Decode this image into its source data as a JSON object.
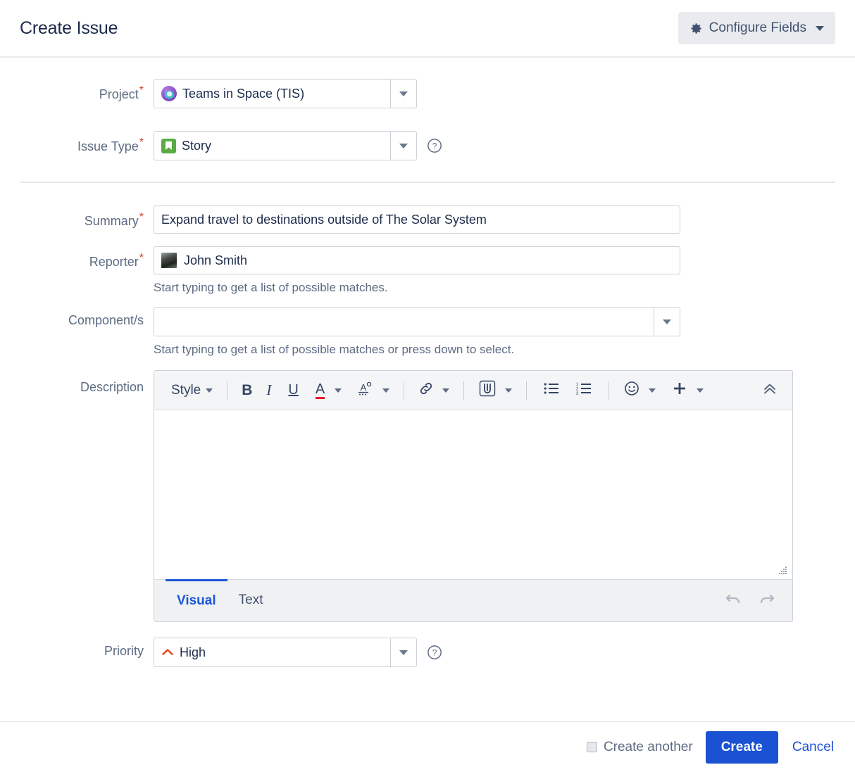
{
  "header": {
    "title": "Create Issue",
    "configure_fields_label": "Configure Fields",
    "gear_icon": "gear-icon",
    "caret_icon": "chevron-down-icon"
  },
  "fields": {
    "project": {
      "label": "Project",
      "required": "*",
      "value": "Teams in Space (TIS)",
      "icon": "project-avatar-icon"
    },
    "issue_type": {
      "label": "Issue Type",
      "required": "*",
      "value": "Story",
      "icon": "story-type-icon",
      "help_icon": "help-icon"
    },
    "summary": {
      "label": "Summary",
      "required": "*",
      "value": "Expand travel to destinations outside of The Solar System",
      "placeholder": ""
    },
    "reporter": {
      "label": "Reporter",
      "required": "*",
      "value": "John Smith",
      "icon": "user-avatar-icon",
      "hint": "Start typing to get a list of possible matches."
    },
    "components": {
      "label": "Component/s",
      "value": "",
      "placeholder": "",
      "hint": "Start typing to get a list of possible matches or press down to select."
    },
    "description": {
      "label": "Description",
      "value": "",
      "toolbar": {
        "style_label": "Style",
        "bold_label": "B",
        "italic_label": "I",
        "underline_label": "U",
        "text_color_label": "A",
        "highlight_label": "A",
        "link_icon": "link-icon",
        "attachment_icon": "paperclip-icon",
        "bullet_list_icon": "bullet-list-icon",
        "numbered_list_icon": "numbered-list-icon",
        "emoji_icon": "emoji-icon",
        "insert_icon": "plus-icon",
        "collapse_icon": "chevron-double-up-icon"
      },
      "tabs": [
        {
          "label": "Visual",
          "active": true
        },
        {
          "label": "Text",
          "active": false
        }
      ],
      "undo_icon": "undo-icon",
      "redo_icon": "redo-icon",
      "resize_icon": "resize-grip-icon"
    },
    "priority": {
      "label": "Priority",
      "value": "High",
      "icon": "priority-high-icon",
      "help_icon": "help-icon"
    }
  },
  "footer": {
    "create_another_label": "Create another",
    "create_another_checked": false,
    "create_label": "Create",
    "cancel_label": "Cancel"
  },
  "colors": {
    "primary_blue": "#1b52d3",
    "required_red": "#d04437",
    "priority_high": "#e8502a",
    "story_green": "#5aab46",
    "label_gray": "#5d6b82",
    "title_navy": "#1c2b4b"
  }
}
